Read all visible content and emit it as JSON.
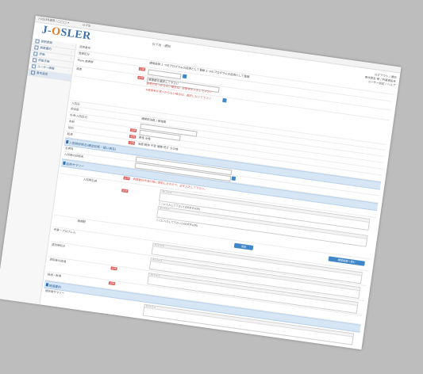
{
  "topbar": {
    "left": "J-OSLER運用 / ◯◯◯ ▾",
    "middle": "ログ出"
  },
  "logo": {
    "part1": "J-",
    "part2": "O",
    "part3": "SLER"
  },
  "header": {
    "search_label": "ログ出 · 通知",
    "right_line1": "ログアウト / 通知",
    "right_line2": "専攻医名 様 / 所属施設名",
    "right_line3": "ユーザー設定 / ヘルプ"
  },
  "sidebar": {
    "items": [
      {
        "label": "症例登録"
      },
      {
        "label": "病歴要約"
      },
      {
        "label": "評価"
      },
      {
        "label": "研修手帳"
      },
      {
        "label": "ユーザー情報"
      },
      {
        "label": "基本設定"
      }
    ]
  },
  "form": {
    "rows": [
      {
        "label": "症例番号",
        "value": ""
      },
      {
        "label": "登録区分",
        "value": "通常症例    1 つのプログラムの症例として登録    2 つのプログラムの症例として登録"
      },
      {
        "label": "Main 疾患群",
        "value": ""
      },
      {
        "label": "疾患",
        "value": "疾患群を選択して下さい",
        "note": "疾患が見つからない場合は、診断名を入力して下さい"
      },
      {
        "label": "",
        "value": "※疾患名が見つからない場合は、選択しないで下さい"
      },
      {
        "label": "入院日",
        "value": ""
      },
      {
        "label": "担当医",
        "value": "通常担当医 / 研修医"
      },
      {
        "label": "外来/入院区分",
        "value": ""
      },
      {
        "label": "年齢",
        "value": ""
      },
      {
        "label": "性別",
        "value": "男性   女性"
      },
      {
        "label": "転帰",
        "value": "治癒    軽快    不変    増悪    死亡    その他"
      }
    ],
    "section1": "入院時診断名(確定診断・疑い病名)",
    "section1_rows": [
      {
        "label": "主病名",
        "value": ""
      },
      {
        "label": "入院時の診断名",
        "value": ""
      }
    ],
    "section2": "症例サマリー",
    "red_note": "病歴要約作成の際に使用しますので、必ず入力して下さい。",
    "editor_hint": "ここに入力して下さい(100文字以内)",
    "summary_label1": "入院時主訴",
    "summary_label2": "現病歴",
    "button_add": "追加",
    "button_right": "確認画面へ進む",
    "sub_rows": [
      {
        "label": "考察・プロブレム"
      },
      {
        "label": "退院時処方"
      },
      {
        "label": "退院後の経過"
      },
      {
        "label": "経過・転帰"
      }
    ],
    "section3": "経過要約",
    "section3_row": "退院時サマリー"
  }
}
